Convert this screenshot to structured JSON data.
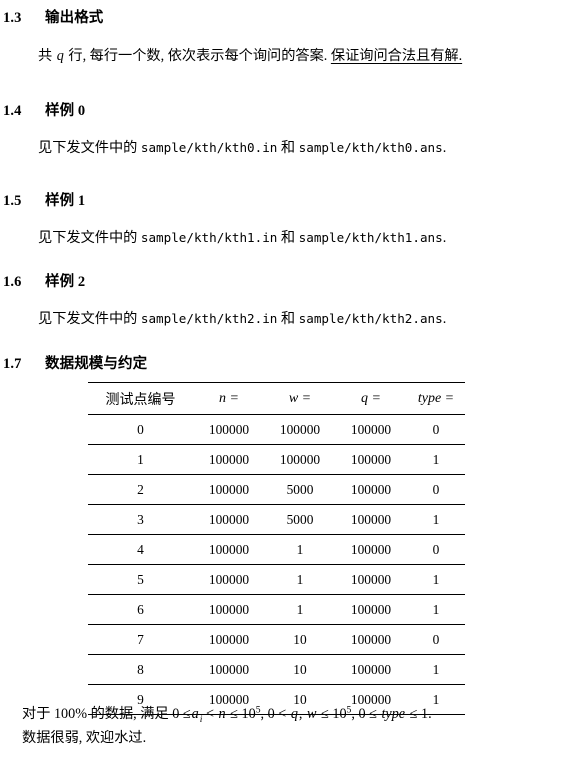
{
  "sections": [
    {
      "num": "1.3",
      "title": "输出格式"
    },
    {
      "num": "1.4",
      "title": "样例 0"
    },
    {
      "num": "1.5",
      "title": "样例 1"
    },
    {
      "num": "1.6",
      "title": "样例 2"
    },
    {
      "num": "1.7",
      "title": "数据规模与约定"
    }
  ],
  "output_format": {
    "lead": "共",
    "var_q": "q",
    "body": "行, 每行一个数, 依次表示每个询问的答案.",
    "emphasis": "保证询问合法且有解."
  },
  "samples": [
    {
      "prefix": "见下发文件中的",
      "in_file": "sample/kth/kth0.in",
      "conj": "和",
      "ans_file": "sample/kth/kth0.ans",
      "period": "."
    },
    {
      "prefix": "见下发文件中的",
      "in_file": "sample/kth/kth1.in",
      "conj": "和",
      "ans_file": "sample/kth/kth1.ans",
      "period": "."
    },
    {
      "prefix": "见下发文件中的",
      "in_file": "sample/kth/kth2.in",
      "conj": "和",
      "ans_file": "sample/kth/kth2.ans",
      "period": "."
    }
  ],
  "table": {
    "headers": [
      "测试点编号",
      "n =",
      "w =",
      "q =",
      "type ="
    ],
    "rows": [
      [
        "0",
        "100000",
        "100000",
        "100000",
        "0"
      ],
      [
        "1",
        "100000",
        "100000",
        "100000",
        "1"
      ],
      [
        "2",
        "100000",
        "5000",
        "100000",
        "0"
      ],
      [
        "3",
        "100000",
        "5000",
        "100000",
        "1"
      ],
      [
        "4",
        "100000",
        "1",
        "100000",
        "0"
      ],
      [
        "5",
        "100000",
        "1",
        "100000",
        "1"
      ],
      [
        "6",
        "100000",
        "1",
        "100000",
        "1"
      ],
      [
        "7",
        "100000",
        "10",
        "100000",
        "0"
      ],
      [
        "8",
        "100000",
        "10",
        "100000",
        "1"
      ],
      [
        "9",
        "100000",
        "10",
        "100000",
        "1"
      ]
    ]
  },
  "constraints": {
    "lead": "对于",
    "percent": "100%",
    "mid": "的数据, 满足",
    "expr_plain": "0 ≤ a_i < n ≤ 10^5, 0 < q, w ≤ 10^5, 0 ≤ type ≤ 1.",
    "parts": {
      "p1": "0 ≤",
      "a": "a",
      "a_sub": "i",
      "p2": "<",
      "n": "n",
      "p3": "≤ 10",
      "exp1": "5",
      "p4": ", 0 <",
      "q": "q",
      "comma": ",",
      "w": "w",
      "p5": "≤ 10",
      "exp2": "5",
      "p6": ", 0 ≤",
      "type": "type",
      "p7": "≤ 1."
    },
    "note": "数据很弱, 欢迎水过."
  }
}
